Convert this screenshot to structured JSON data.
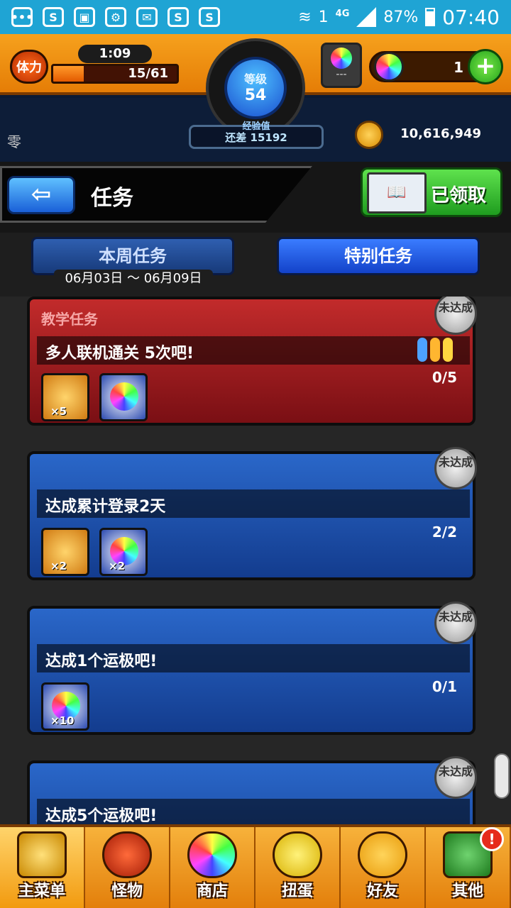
{
  "status_bar": {
    "network": "4G",
    "sim": "1",
    "battery": "87%",
    "time": "07:40"
  },
  "header": {
    "stamina_label": "体力",
    "stamina_timer": "1:09",
    "stamina_value": "15/61",
    "stamina_fraction": 0.246,
    "level_label": "等级",
    "level": "54",
    "exp_label": "经验值",
    "exp_remaining": "还差 15192",
    "helmet_text": "---",
    "orb_count": "1",
    "player_name": "零",
    "coins": "10,616,949"
  },
  "title_bar": {
    "title": "任务",
    "claimed_label": "已领取"
  },
  "tabs": {
    "weekly": "本周任务",
    "special": "特别任务",
    "date_range": "06月03日 ～ 06月09日"
  },
  "badge_text": "未达成",
  "missions": [
    {
      "category": "教学任务",
      "title": "多人联机通关 5次吧!",
      "progress": "0/5",
      "rewards": [
        {
          "type": "char",
          "qty": "×5"
        },
        {
          "type": "orb",
          "qty": ""
        }
      ]
    },
    {
      "category": "",
      "title": "达成累计登录2天",
      "progress": "2/2",
      "rewards": [
        {
          "type": "char",
          "qty": "×2"
        },
        {
          "type": "orb",
          "qty": "×2"
        }
      ]
    },
    {
      "category": "",
      "title": "达成1个运极吧!",
      "progress": "0/1",
      "rewards": [
        {
          "type": "orb",
          "qty": "×10"
        }
      ]
    },
    {
      "category": "",
      "title": "达成5个运极吧!",
      "progress": "",
      "rewards": []
    }
  ],
  "bottom_nav": [
    {
      "label": "主菜单",
      "icon": "home-icon"
    },
    {
      "label": "怪物",
      "icon": "monster-icon"
    },
    {
      "label": "商店",
      "icon": "shop-icon"
    },
    {
      "label": "扭蛋",
      "icon": "gacha-icon"
    },
    {
      "label": "好友",
      "icon": "friends-icon"
    },
    {
      "label": "其他",
      "icon": "other-icon"
    }
  ],
  "notify_badge": "!"
}
